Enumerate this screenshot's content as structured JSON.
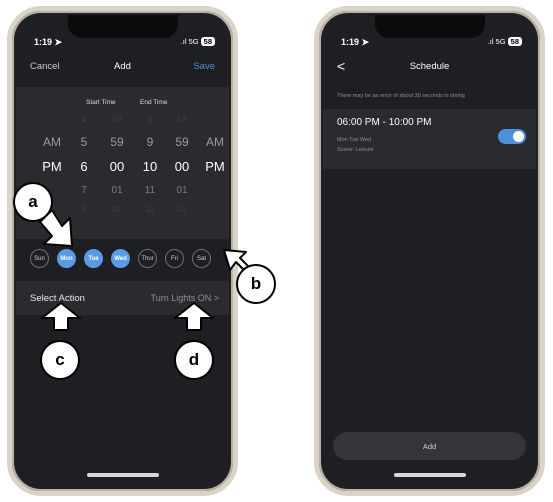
{
  "left_phone": {
    "status": {
      "time": "1:19 ➤",
      "signal": ".ıl 5G",
      "battery": "58"
    },
    "nav": {
      "cancel": "Cancel",
      "title": "Add",
      "save": "Save"
    },
    "picker": {
      "start_label": "Start Time",
      "end_label": "End Time",
      "rows": [
        {
          "ampm": "",
          "h1": "4",
          "m1": "58",
          "h2": "8",
          "m2": "58",
          "ampm2": ""
        },
        {
          "ampm": "AM",
          "h1": "5",
          "m1": "59",
          "h2": "9",
          "m2": "59",
          "ampm2": "AM"
        },
        {
          "ampm": "PM",
          "h1": "6",
          "m1": "00",
          "h2": "10",
          "m2": "00",
          "ampm2": "PM"
        },
        {
          "ampm": "",
          "h1": "7",
          "m1": "01",
          "h2": "11",
          "m2": "01",
          "ampm2": ""
        },
        {
          "ampm": "",
          "h1": "8",
          "m1": "02",
          "h2": "12",
          "m2": "02",
          "ampm2": ""
        }
      ]
    },
    "days": [
      {
        "label": "Sun",
        "selected": false
      },
      {
        "label": "Mon",
        "selected": true
      },
      {
        "label": "Tue",
        "selected": true
      },
      {
        "label": "Wed",
        "selected": true
      },
      {
        "label": "Thur",
        "selected": false
      },
      {
        "label": "Fri",
        "selected": false
      },
      {
        "label": "Sat",
        "selected": false
      }
    ],
    "action": {
      "label": "Select Action",
      "value": "Turn Lights ON >"
    }
  },
  "right_phone": {
    "status": {
      "time": "1:19 ➤",
      "signal": ".ıl 5G",
      "battery": "58"
    },
    "nav": {
      "back": "<",
      "title": "Schedule"
    },
    "note": "There may be an error of about 30 seconds in timing",
    "schedule": {
      "range": "06:00 PM - 10:00 PM",
      "days": "Mon Tue Wed",
      "scene": "Scene: Leisure",
      "enabled": true
    },
    "add_button": "Add"
  },
  "callouts": {
    "a": "a",
    "b": "b",
    "c": "c",
    "d": "d"
  },
  "colors": {
    "accent": "#4f8fdb",
    "day_selected": "#5a9be6",
    "screen_bg": "#1e1f22",
    "card_bg": "#2a2b2f"
  }
}
